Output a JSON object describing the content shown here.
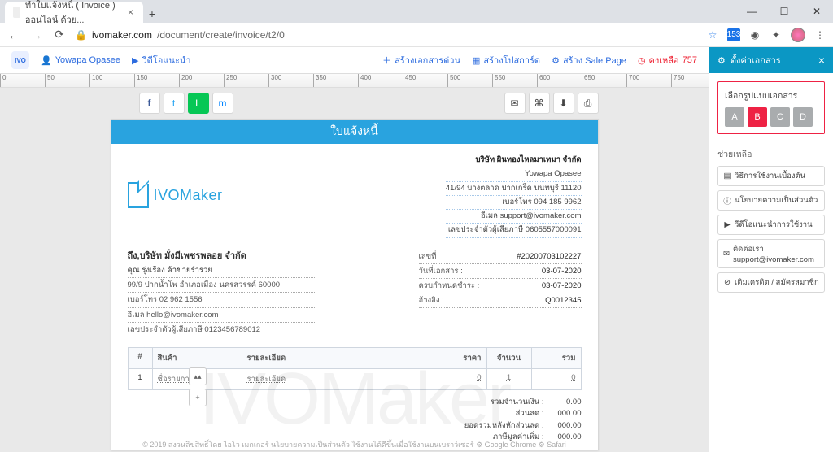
{
  "browser": {
    "tab_title": "ทำใบแจ้งหนี้ ( Invoice ) ออนไลน์ ด้วย...",
    "url_host": "ivomaker.com",
    "url_path": "/document/create/invoice/t2/0",
    "ext_badge": "153"
  },
  "appbar": {
    "logo": "IVO",
    "user": "Yowapa Opasee",
    "video": "วีดีโอแนะนำ",
    "quickdoc": "สร้างเอกสารด่วน",
    "postcard": "สร้างโปสการ์ด",
    "salepage": "สร้าง Sale Page",
    "remaining_label": "คงเหลือ",
    "remaining_value": "757"
  },
  "ruler": [
    "0",
    "50",
    "100",
    "150",
    "200",
    "250",
    "300",
    "350",
    "400",
    "450",
    "500",
    "550",
    "600",
    "650",
    "700",
    "750"
  ],
  "social": {
    "facebook": "f",
    "twitter": "t",
    "line": "L",
    "messenger": "m"
  },
  "tools": {
    "mail": "✉",
    "chat": "⌘",
    "download": "⬇",
    "print": "⎙"
  },
  "doc": {
    "watermark": "IVOMaker",
    "title": "ใบแจ้งหนี้",
    "brand": "IVOMaker",
    "company": {
      "name": "บริษัท ผินทองไหลมาเทมา จำกัด",
      "contact": "Yowapa Opasee",
      "address": "41/94 บางตลาด ปากเกร็ด นนทบุรี 11120",
      "phone": "เบอร์โทร 094 185 9962",
      "email": "อีเมล support@ivomaker.com",
      "taxid": "เลขประจำตัวผู้เสียภาษี 0605557000091"
    },
    "to": {
      "heading": "ถึง,บริษัท มั่งมีเพชรพลอย จำกัด",
      "contact": "คุณ รุ่งเรือง ค้าขายร่ำรวย",
      "address": "99/9 ปากน้ำโพ อำเภอเมือง นครสวรรค์ 60000",
      "phone": "เบอร์โทร 02 962 1556",
      "email": "อีเมล hello@ivomaker.com",
      "taxid": "เลขประจำตัวผู้เสียภาษี 0123456789012"
    },
    "meta": {
      "docno_label": "เลขที่",
      "docno": "#20200703102227",
      "date_label": "วันที่เอกสาร :",
      "date": "03-07-2020",
      "due_label": "ครบกำหนดชำระ :",
      "due": "03-07-2020",
      "ref_label": "อ้างอิง :",
      "ref": "Q0012345"
    },
    "table": {
      "head": {
        "idx": "#",
        "name": "สินค้า",
        "desc": "รายละเอียด",
        "price": "ราคา",
        "qty": "จำนวน",
        "total": "รวม"
      },
      "row": {
        "idx": "1",
        "name": "ชื่อรายการ",
        "desc": "รายละเอียด",
        "price": "0",
        "qty": "1",
        "total": "0"
      }
    },
    "summary": {
      "subtotal_label": "รวมจำนวนเงิน :",
      "subtotal": "0.00",
      "discount_label": "ส่วนลด :",
      "discount": "000.00",
      "afterdisc_label": "ยอดรวมหลังหักส่วนลด :",
      "afterdisc": "000.00",
      "vat_label": "ภาษีมูลค่าเพิ่ม :",
      "vat": "000.00"
    }
  },
  "footer": "© 2019 สงวนลิขสิทธิ์โดย ไอโว เมกเกอร์ นโยบายความเป็นส่วนตัว ใช้งานได้ดีขึ้นเมื่อใช้งานบนเบราว์เซอร์ ⚙ Google Chrome ⚙ Safari",
  "rpanel": {
    "title": "ตั้งค่าเอกสาร",
    "group_label": "เลือกรูปแบบเอกสาร",
    "group_opts": [
      "A",
      "B",
      "C",
      "D"
    ],
    "group_active": "B",
    "help_label": "ช่วยเหลือ",
    "help": [
      {
        "icon": "▤",
        "label": "วิธีการใช้งานเบื้องต้น"
      },
      {
        "icon": "ⓘ",
        "label": "นโยบายความเป็นส่วนตัว"
      },
      {
        "icon": "▶",
        "label": "วีดีโอแนะนำการใช้งาน"
      },
      {
        "icon": "✉",
        "label": "ติดต่อเรา support@ivomaker.com"
      },
      {
        "icon": "⊘",
        "label": "เติมเครดิต / สมัครสมาชิก"
      }
    ]
  },
  "sidebtns": {
    "up": "▴▴",
    "down": "+"
  }
}
